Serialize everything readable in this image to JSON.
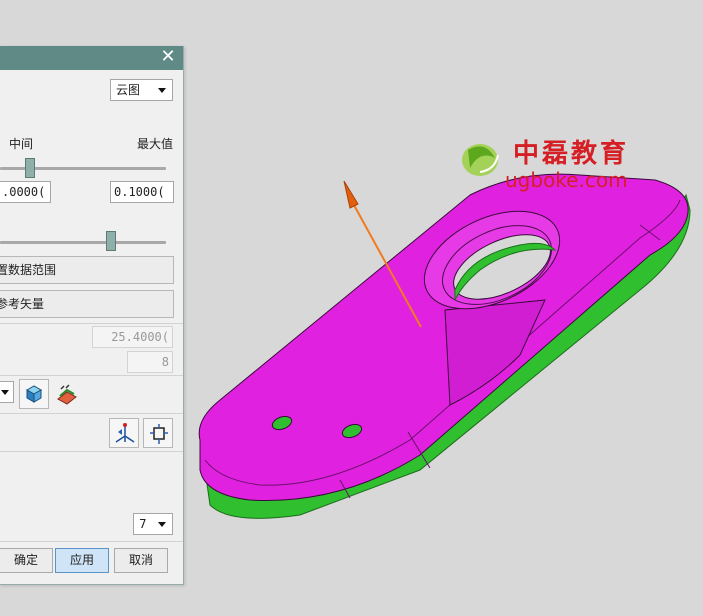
{
  "dialog": {
    "display_mode": "云图",
    "labels": {
      "middle": "中间",
      "max": "最大值"
    },
    "range": {
      "min_value": ".0000(",
      "max_value": "0.1000(",
      "slider_position": 0.16
    },
    "second_slider_position": 0.68,
    "buttons": {
      "set_data_range": "置数据范围",
      "reference_vector": "参考矢量"
    },
    "fields": {
      "value_disabled": "25.4000(",
      "count_disabled": "8"
    },
    "levels_dropdown": "7",
    "footer": {
      "ok": "确定",
      "apply": "应用",
      "cancel": "取消"
    },
    "icons": [
      "shaded-view-cube-icon",
      "face-analysis-display-icon",
      "vector-axis-icon",
      "swap-direction-icon",
      "close-icon",
      "dropdown-arrow-icon"
    ]
  },
  "viewport": {
    "watermark": {
      "chinese": "中磊教育",
      "url": "ugboke.com"
    },
    "model_colors": {
      "top_face": "#e022e0",
      "side_face": "#2fbf2f",
      "vector": "#f07a20"
    }
  }
}
